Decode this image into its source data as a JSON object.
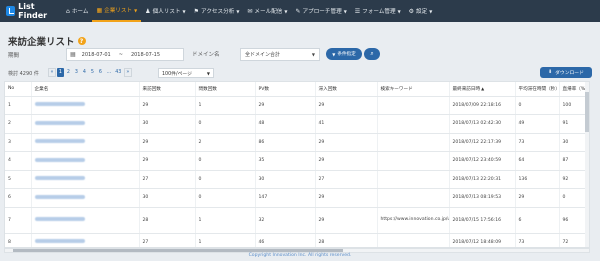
{
  "app": {
    "name": "List Finder"
  },
  "nav": [
    {
      "label": "ホーム",
      "icon": "⌂",
      "active": false,
      "caret": false
    },
    {
      "label": "企業リスト",
      "icon": "▦",
      "active": true,
      "caret": true
    },
    {
      "label": "個人リスト",
      "icon": "♟",
      "active": false,
      "caret": true
    },
    {
      "label": "アクセス分析",
      "icon": "⚑",
      "active": false,
      "caret": true
    },
    {
      "label": "メール配信",
      "icon": "✉",
      "active": false,
      "caret": true
    },
    {
      "label": "アプローチ管理",
      "icon": "✎",
      "active": false,
      "caret": true
    },
    {
      "label": "フォーム管理",
      "icon": "☰",
      "active": false,
      "caret": true
    },
    {
      "label": "設定",
      "icon": "⚙",
      "active": false,
      "caret": true
    }
  ],
  "page": {
    "title": "来訪企業リスト",
    "help": "?"
  },
  "filters": {
    "period_label": "期間",
    "date_from": "2018-07-01",
    "date_sep": "~",
    "date_to": "2018-07-15",
    "domain_label": "ドメイン名",
    "domain_value": "全ドメイン合計",
    "condition_button": "条件指定",
    "search_icon": "search-icon"
  },
  "pager": {
    "count_text": "検討 4290 件",
    "prev": "«",
    "pages": [
      "1",
      "2",
      "3",
      "4",
      "5",
      "6",
      "…",
      "43"
    ],
    "current": "1",
    "next": "»",
    "per_page": "100件/ページ",
    "download": "ダウンロード"
  },
  "table": {
    "columns": [
      "No",
      "企業名",
      "来訪回数",
      "問数回数",
      "PV数",
      "滞入回数",
      "検索キーワード",
      "最終来訪日時",
      "平均滞在時間（秒）",
      "直帰率（%）"
    ],
    "sort_column": 7,
    "rows": [
      [
        "1",
        "",
        "29",
        "1",
        "29",
        "29",
        "",
        "2018/07/09 22:18:16",
        "0",
        "100"
      ],
      [
        "2",
        "",
        "30",
        "0",
        "48",
        "41",
        "",
        "2018/07/13 02:42:30",
        "49",
        "91"
      ],
      [
        "3",
        "",
        "29",
        "2",
        "86",
        "29",
        "",
        "2018/07/12 22:17:39",
        "73",
        "30"
      ],
      [
        "4",
        "",
        "29",
        "0",
        "35",
        "29",
        "",
        "2018/07/12 23:40:59",
        "64",
        "87"
      ],
      [
        "5",
        "",
        "27",
        "0",
        "30",
        "27",
        "",
        "2018/07/13 22:20:31",
        "136",
        "92"
      ],
      [
        "6",
        "",
        "30",
        "0",
        "147",
        "29",
        "",
        "2018/07/13 08:19:53",
        "29",
        "0"
      ],
      [
        "7",
        "",
        "28",
        "1",
        "32",
        "29",
        "https://www.innovation.co.jp/urumo.php/",
        "2018/07/15 17:56:16",
        "6",
        "96"
      ],
      [
        "8",
        "",
        "27",
        "1",
        "46",
        "28",
        "",
        "2018/07/12 18:48:09",
        "73",
        "72"
      ]
    ]
  },
  "footer": "Copyright Innovation Inc. All rights reserved."
}
